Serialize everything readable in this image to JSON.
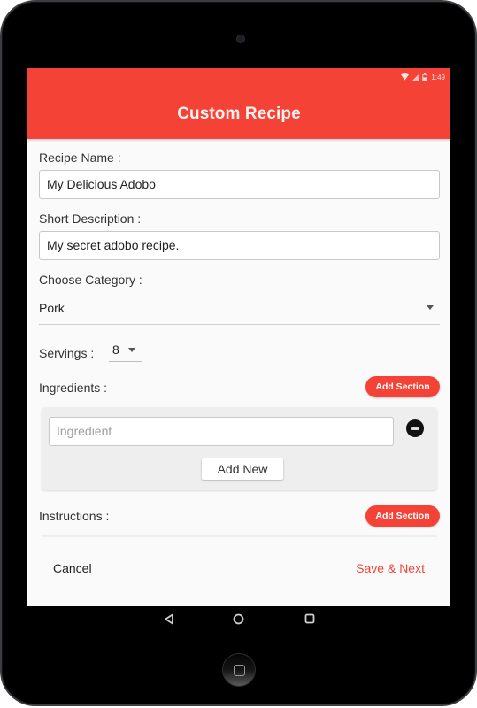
{
  "status_bar": {
    "time": "1:49",
    "icons": [
      "wifi-icon",
      "signal-icon",
      "battery-icon"
    ]
  },
  "app_bar": {
    "title": "Custom Recipe"
  },
  "form": {
    "recipe_name": {
      "label": "Recipe Name :",
      "value": "My Delicious Adobo"
    },
    "short_description": {
      "label": "Short Description :",
      "value": "My secret adobo recipe."
    },
    "category": {
      "label": "Choose Category :",
      "selected": "Pork"
    },
    "servings": {
      "label": "Servings :",
      "selected": "8"
    },
    "ingredients": {
      "label": "Ingredients :",
      "add_section_label": "Add Section",
      "items": [
        {
          "value": "",
          "placeholder": "Ingredient"
        }
      ],
      "add_new_label": "Add New"
    },
    "instructions": {
      "label": "Instructions :",
      "add_section_label": "Add Section"
    }
  },
  "footer": {
    "cancel_label": "Cancel",
    "save_next_label": "Save & Next"
  },
  "colors": {
    "accent": "#f44336",
    "footer_accent_text": "#f44336"
  },
  "navigation": {
    "icons": [
      "back-icon",
      "home-icon",
      "recents-icon"
    ]
  }
}
